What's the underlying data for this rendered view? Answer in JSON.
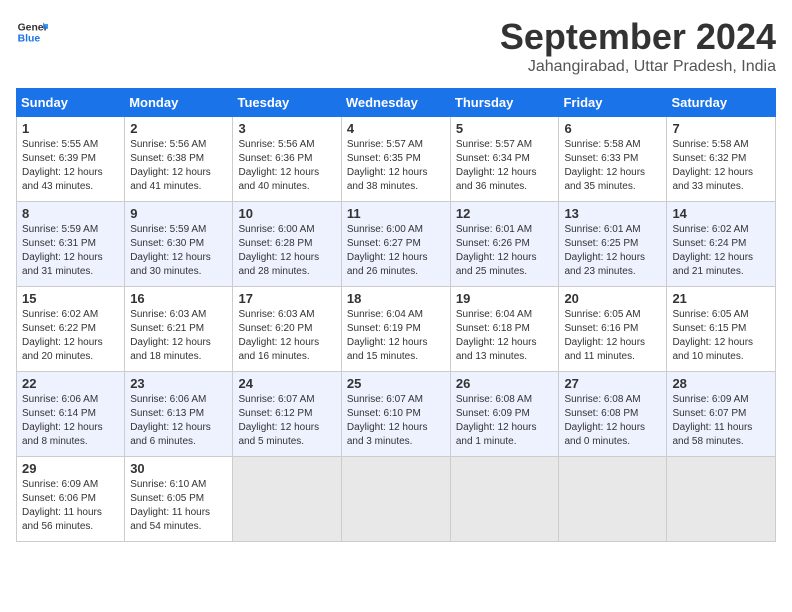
{
  "header": {
    "logo_line1": "General",
    "logo_line2": "Blue",
    "month_title": "September 2024",
    "location": "Jahangirabad, Uttar Pradesh, India"
  },
  "weekdays": [
    "Sunday",
    "Monday",
    "Tuesday",
    "Wednesday",
    "Thursday",
    "Friday",
    "Saturday"
  ],
  "weeks": [
    [
      {
        "day": "1",
        "info": "Sunrise: 5:55 AM\nSunset: 6:39 PM\nDaylight: 12 hours\nand 43 minutes."
      },
      {
        "day": "2",
        "info": "Sunrise: 5:56 AM\nSunset: 6:38 PM\nDaylight: 12 hours\nand 41 minutes."
      },
      {
        "day": "3",
        "info": "Sunrise: 5:56 AM\nSunset: 6:36 PM\nDaylight: 12 hours\nand 40 minutes."
      },
      {
        "day": "4",
        "info": "Sunrise: 5:57 AM\nSunset: 6:35 PM\nDaylight: 12 hours\nand 38 minutes."
      },
      {
        "day": "5",
        "info": "Sunrise: 5:57 AM\nSunset: 6:34 PM\nDaylight: 12 hours\nand 36 minutes."
      },
      {
        "day": "6",
        "info": "Sunrise: 5:58 AM\nSunset: 6:33 PM\nDaylight: 12 hours\nand 35 minutes."
      },
      {
        "day": "7",
        "info": "Sunrise: 5:58 AM\nSunset: 6:32 PM\nDaylight: 12 hours\nand 33 minutes."
      }
    ],
    [
      {
        "day": "8",
        "info": "Sunrise: 5:59 AM\nSunset: 6:31 PM\nDaylight: 12 hours\nand 31 minutes."
      },
      {
        "day": "9",
        "info": "Sunrise: 5:59 AM\nSunset: 6:30 PM\nDaylight: 12 hours\nand 30 minutes."
      },
      {
        "day": "10",
        "info": "Sunrise: 6:00 AM\nSunset: 6:28 PM\nDaylight: 12 hours\nand 28 minutes."
      },
      {
        "day": "11",
        "info": "Sunrise: 6:00 AM\nSunset: 6:27 PM\nDaylight: 12 hours\nand 26 minutes."
      },
      {
        "day": "12",
        "info": "Sunrise: 6:01 AM\nSunset: 6:26 PM\nDaylight: 12 hours\nand 25 minutes."
      },
      {
        "day": "13",
        "info": "Sunrise: 6:01 AM\nSunset: 6:25 PM\nDaylight: 12 hours\nand 23 minutes."
      },
      {
        "day": "14",
        "info": "Sunrise: 6:02 AM\nSunset: 6:24 PM\nDaylight: 12 hours\nand 21 minutes."
      }
    ],
    [
      {
        "day": "15",
        "info": "Sunrise: 6:02 AM\nSunset: 6:22 PM\nDaylight: 12 hours\nand 20 minutes."
      },
      {
        "day": "16",
        "info": "Sunrise: 6:03 AM\nSunset: 6:21 PM\nDaylight: 12 hours\nand 18 minutes."
      },
      {
        "day": "17",
        "info": "Sunrise: 6:03 AM\nSunset: 6:20 PM\nDaylight: 12 hours\nand 16 minutes."
      },
      {
        "day": "18",
        "info": "Sunrise: 6:04 AM\nSunset: 6:19 PM\nDaylight: 12 hours\nand 15 minutes."
      },
      {
        "day": "19",
        "info": "Sunrise: 6:04 AM\nSunset: 6:18 PM\nDaylight: 12 hours\nand 13 minutes."
      },
      {
        "day": "20",
        "info": "Sunrise: 6:05 AM\nSunset: 6:16 PM\nDaylight: 12 hours\nand 11 minutes."
      },
      {
        "day": "21",
        "info": "Sunrise: 6:05 AM\nSunset: 6:15 PM\nDaylight: 12 hours\nand 10 minutes."
      }
    ],
    [
      {
        "day": "22",
        "info": "Sunrise: 6:06 AM\nSunset: 6:14 PM\nDaylight: 12 hours\nand 8 minutes."
      },
      {
        "day": "23",
        "info": "Sunrise: 6:06 AM\nSunset: 6:13 PM\nDaylight: 12 hours\nand 6 minutes."
      },
      {
        "day": "24",
        "info": "Sunrise: 6:07 AM\nSunset: 6:12 PM\nDaylight: 12 hours\nand 5 minutes."
      },
      {
        "day": "25",
        "info": "Sunrise: 6:07 AM\nSunset: 6:10 PM\nDaylight: 12 hours\nand 3 minutes."
      },
      {
        "day": "26",
        "info": "Sunrise: 6:08 AM\nSunset: 6:09 PM\nDaylight: 12 hours\nand 1 minute."
      },
      {
        "day": "27",
        "info": "Sunrise: 6:08 AM\nSunset: 6:08 PM\nDaylight: 12 hours\nand 0 minutes."
      },
      {
        "day": "28",
        "info": "Sunrise: 6:09 AM\nSunset: 6:07 PM\nDaylight: 11 hours\nand 58 minutes."
      }
    ],
    [
      {
        "day": "29",
        "info": "Sunrise: 6:09 AM\nSunset: 6:06 PM\nDaylight: 11 hours\nand 56 minutes."
      },
      {
        "day": "30",
        "info": "Sunrise: 6:10 AM\nSunset: 6:05 PM\nDaylight: 11 hours\nand 54 minutes."
      },
      {
        "day": "",
        "info": ""
      },
      {
        "day": "",
        "info": ""
      },
      {
        "day": "",
        "info": ""
      },
      {
        "day": "",
        "info": ""
      },
      {
        "day": "",
        "info": ""
      }
    ]
  ]
}
